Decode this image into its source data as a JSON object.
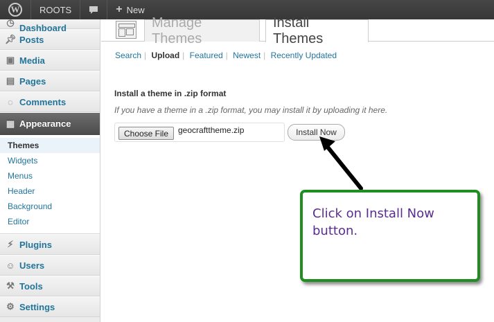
{
  "adminbar": {
    "site_name": "ROOTS",
    "new_label": "New"
  },
  "sidebar": {
    "items": [
      {
        "label": "Dashboard",
        "icon": "dashboard-icon"
      },
      {
        "label": "Posts",
        "icon": "pushpin-icon"
      },
      {
        "label": "Media",
        "icon": "camera-icon"
      },
      {
        "label": "Pages",
        "icon": "pages-icon"
      },
      {
        "label": "Comments",
        "icon": "comment-icon"
      },
      {
        "label": "Appearance",
        "icon": "appearance-icon"
      },
      {
        "label": "Plugins",
        "icon": "plug-icon"
      },
      {
        "label": "Users",
        "icon": "users-icon"
      },
      {
        "label": "Tools",
        "icon": "tools-icon"
      },
      {
        "label": "Settings",
        "icon": "settings-icon"
      }
    ],
    "submenu": [
      "Themes",
      "Widgets",
      "Menus",
      "Header",
      "Background",
      "Editor"
    ]
  },
  "tabs": {
    "manage": "Manage Themes",
    "install": "Install Themes"
  },
  "upload_nav": [
    "Search",
    "Upload",
    "Featured",
    "Newest",
    "Recently Updated"
  ],
  "install": {
    "title": "Install a theme in .zip format",
    "description": "If you have a theme in a .zip format, you may install it by uploading it here.",
    "choose_file_label": "Choose File",
    "file_name": "geocrafttheme.zip",
    "install_button": "Install Now"
  },
  "callout": {
    "text": "Click on Install Now button.",
    "border_color": "#1f8d1f",
    "text_color": "#5b2c8f"
  }
}
